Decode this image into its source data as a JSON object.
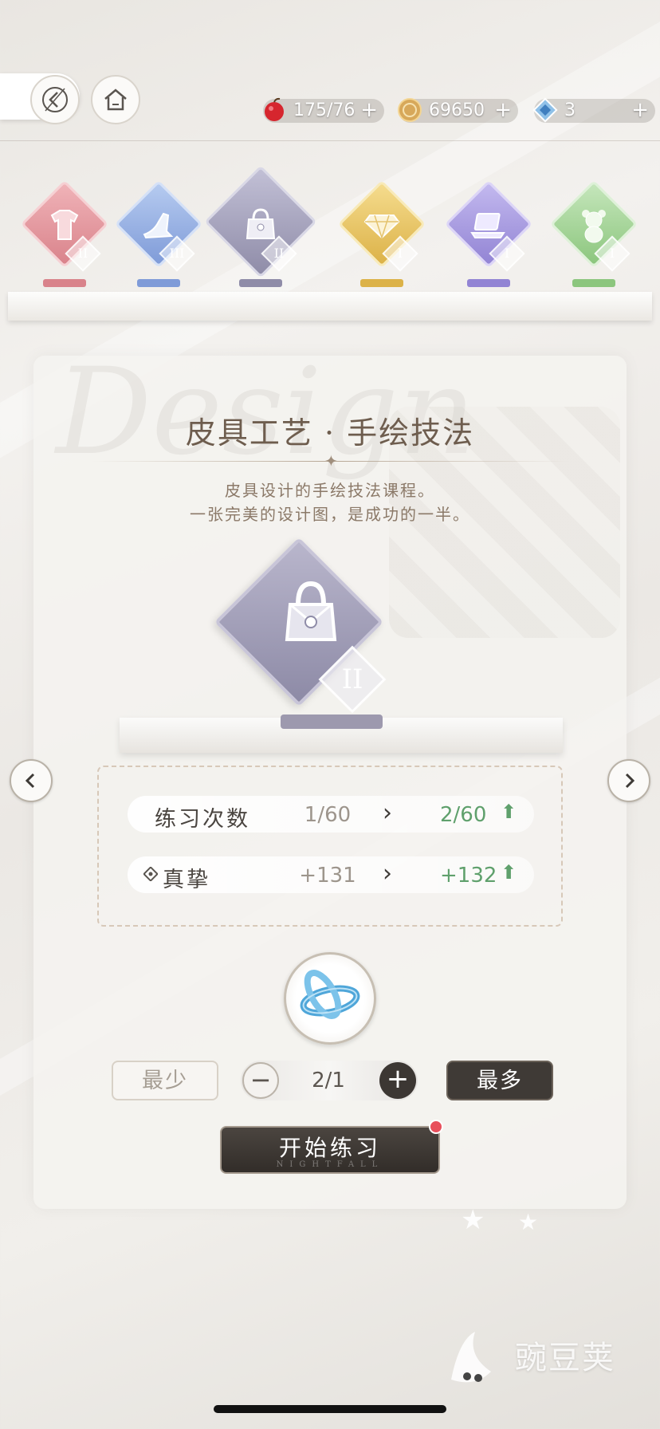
{
  "resources": [
    {
      "icon": "apple-icon",
      "value": "175/76",
      "plus": "+"
    },
    {
      "icon": "coin-icon",
      "value": "69650",
      "plus": "+"
    },
    {
      "icon": "diamond-icon",
      "value": "3",
      "plus": "+"
    }
  ],
  "categories": [
    {
      "icon": "clothing-icon",
      "level": "II",
      "color": "#e49aa0"
    },
    {
      "icon": "high-heel-icon",
      "level": "III",
      "color": "#96b0e6"
    },
    {
      "icon": "handbag-icon",
      "level": "II",
      "color": "#a8a6c2"
    },
    {
      "icon": "gem-icon",
      "level": "I",
      "color": "#eacb6a"
    },
    {
      "icon": "laptop-icon",
      "level": "I",
      "color": "#ab9ee0"
    },
    {
      "icon": "teddy-bear-icon",
      "level": "I",
      "color": "#a9d69d"
    }
  ],
  "course": {
    "background_script": "Design",
    "title": "皮具工艺 · 手绘技法",
    "desc_line1": "皮具设计的手绘技法课程。",
    "desc_line2": "一张完美的设计图，是成功的一半。",
    "level": "II"
  },
  "stats": [
    {
      "label": "练习次数",
      "current": "1/60",
      "arrow": "›",
      "next": "2/60",
      "up": "⬆"
    },
    {
      "label": "真挚",
      "current": "+131",
      "arrow": "›",
      "next": "+132",
      "up": "⬆"
    }
  ],
  "controls": {
    "min_label": "最少",
    "minus": "−",
    "quantity": "2/1",
    "plus": "+",
    "max_label": "最多",
    "start_label": "开始练习",
    "start_sub": "NIGHTFALL"
  },
  "watermark": "豌豆荚"
}
